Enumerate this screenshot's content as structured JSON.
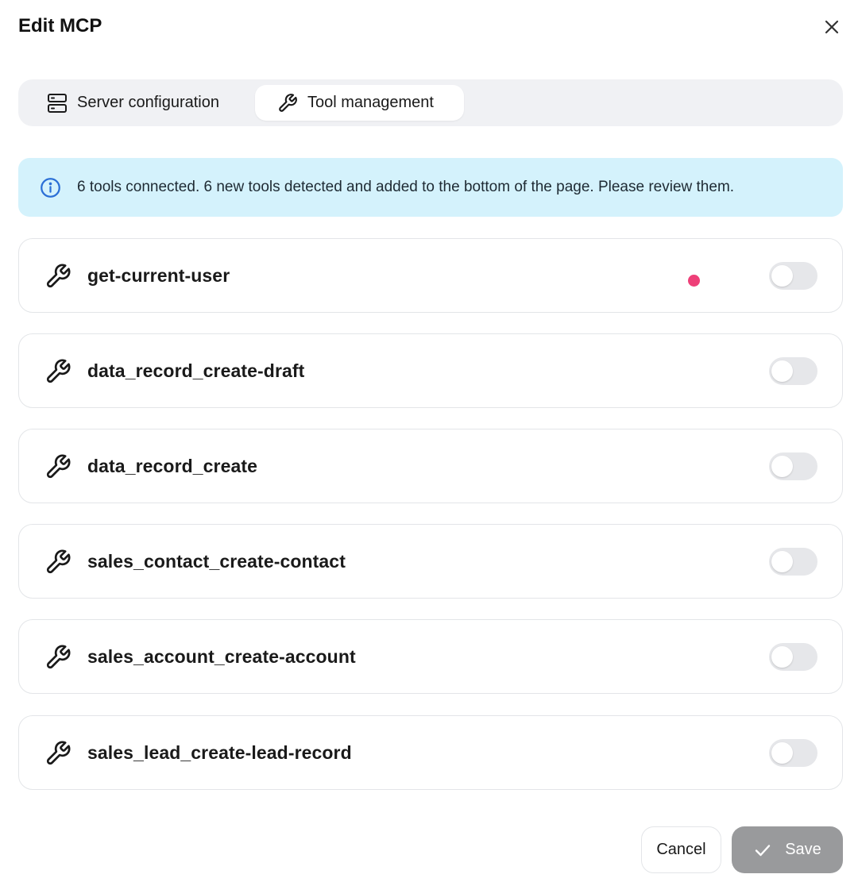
{
  "dialog": {
    "title": "Edit MCP"
  },
  "tabs": [
    {
      "label": "Server configuration",
      "icon": "server-icon",
      "active": false
    },
    {
      "label": "Tool management",
      "icon": "wrench-icon",
      "active": true
    }
  ],
  "banner": {
    "icon": "info-icon",
    "text": "6 tools connected. 6 new tools detected and added to the bottom of the page. Please review them."
  },
  "tools": [
    {
      "name": "get-current-user",
      "enabled": false,
      "new_indicator": true
    },
    {
      "name": "data_record_create-draft",
      "enabled": false
    },
    {
      "name": "data_record_create",
      "enabled": false
    },
    {
      "name": "sales_contact_create-contact",
      "enabled": false
    },
    {
      "name": "sales_account_create-account",
      "enabled": false
    },
    {
      "name": "sales_lead_create-lead-record",
      "enabled": false
    }
  ],
  "footer": {
    "cancel_label": "Cancel",
    "save_label": "Save"
  },
  "colors": {
    "banner_bg": "#d4f2fc",
    "indicator_dot": "#ee3f78",
    "save_disabled": "#999a9c",
    "tabs_bg": "#f0f1f4"
  }
}
